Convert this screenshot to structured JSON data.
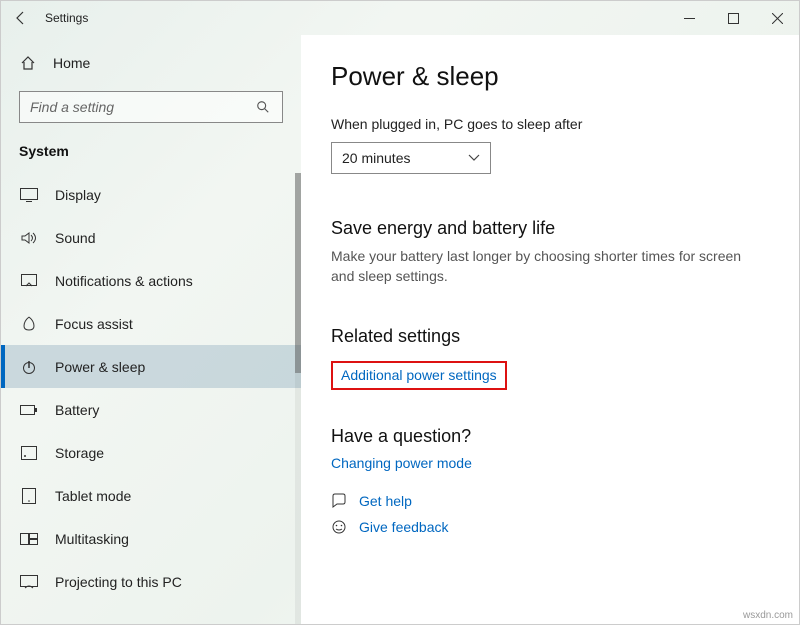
{
  "window": {
    "title": "Settings"
  },
  "sidebar": {
    "home_label": "Home",
    "search_placeholder": "Find a setting",
    "category": "System",
    "items": [
      {
        "label": "Display",
        "icon": "display-icon"
      },
      {
        "label": "Sound",
        "icon": "sound-icon"
      },
      {
        "label": "Notifications & actions",
        "icon": "notifications-icon"
      },
      {
        "label": "Focus assist",
        "icon": "focus-icon"
      },
      {
        "label": "Power & sleep",
        "icon": "power-icon"
      },
      {
        "label": "Battery",
        "icon": "battery-icon"
      },
      {
        "label": "Storage",
        "icon": "storage-icon"
      },
      {
        "label": "Tablet mode",
        "icon": "tablet-icon"
      },
      {
        "label": "Multitasking",
        "icon": "multitasking-icon"
      },
      {
        "label": "Projecting to this PC",
        "icon": "projecting-icon"
      }
    ],
    "active_index": 4
  },
  "content": {
    "heading": "Power & sleep",
    "sleep_label": "When plugged in, PC goes to sleep after",
    "sleep_value": "20 minutes",
    "save_energy_heading": "Save energy and battery life",
    "save_energy_desc": "Make your battery last longer by choosing shorter times for screen and sleep settings.",
    "related_heading": "Related settings",
    "related_link": "Additional power settings",
    "question_heading": "Have a question?",
    "question_link": "Changing power mode",
    "help_links": [
      {
        "label": "Get help"
      },
      {
        "label": "Give feedback"
      }
    ]
  },
  "watermark": "wsxdn.com"
}
